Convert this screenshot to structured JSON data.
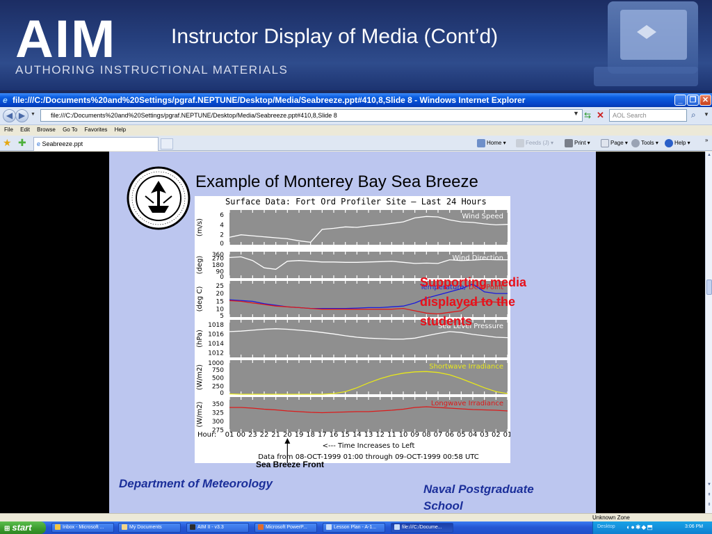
{
  "slide": {
    "logo_text": "AIM",
    "logo_subtitle": "AUTHORING INSTRUCTIONAL MATERIALS",
    "title": "Instructor Display of Media (Cont’d)"
  },
  "browser": {
    "title": "file:///C:/Documents%20and%20Settings/pgraf.NEPTUNE/Desktop/Media/Seabreeze.ppt#410,8,Slide 8 - Windows Internet Explorer",
    "address": "file:///C:/Documents%20and%20Settings/pgraf.NEPTUNE/Desktop/Media/Seabreeze.ppt#410,8,Slide 8",
    "search_placeholder": "AOL Search",
    "menu": [
      "File",
      "Edit",
      "Browse",
      "Go To",
      "Favorites",
      "Help"
    ],
    "tab_label": "Seabreeze.ppt",
    "commands": {
      "home": "Home",
      "feeds": "Feeds (J)",
      "print": "Print",
      "page": "Page",
      "tools": "Tools",
      "help": "Help"
    },
    "status_zone": "Unknown Zone"
  },
  "content": {
    "chart_heading": "Example of Monterey Bay Sea Breeze",
    "annotation": "Supporting media displayed to the students",
    "footer_left": "Department of Meteorology",
    "footer_right": "Naval  Postgraduate School",
    "seabreeze_label": "Sea Breeze Front"
  },
  "chart_data": {
    "type": "line",
    "title": "Surface  Data:  Fort  Ord  Profiler  Site  —  Last  24  Hours",
    "x_tick_labels": [
      "01",
      "00",
      "23",
      "22",
      "21",
      "20",
      "19",
      "18",
      "17",
      "16",
      "15",
      "14",
      "13",
      "12",
      "11",
      "10",
      "09",
      "08",
      "07",
      "06",
      "05",
      "04",
      "03",
      "02",
      "01"
    ],
    "x_prefix": "Hour:",
    "x_note": "<---  Time  Increases  to  Left",
    "x_caption": "Data  from  08-OCT-1999  01:00  through  09-OCT-1999  00:58  UTC",
    "panels": [
      {
        "name": "Wind  Speed",
        "ylabel": "(m/s)",
        "ticks": [
          "6",
          "4",
          "2",
          "0"
        ],
        "ylim": [
          0,
          7
        ],
        "color": "#ffffff",
        "values": [
          1.5,
          2.0,
          1.8,
          1.6,
          1.4,
          1.2,
          0.8,
          0.5,
          3.1,
          3.3,
          3.6,
          3.5,
          3.8,
          4.0,
          4.3,
          4.6,
          5.4,
          5.7,
          5.6,
          5.0,
          4.6,
          4.5,
          4.2,
          4.0,
          4.1
        ]
      },
      {
        "name": "Wind  Direction",
        "ylabel": "(deg)",
        "ticks": [
          "360",
          "270",
          "180",
          "90",
          "0"
        ],
        "ylim": [
          0,
          360
        ],
        "color": "#ffffff",
        "values": [
          280,
          290,
          240,
          140,
          120,
          230,
          240,
          230,
          220,
          220,
          215,
          215,
          220,
          225,
          230,
          215,
          200,
          205,
          200,
          250,
          240,
          245,
          255,
          250,
          250
        ]
      },
      {
        "name": "Temperature/  Dew  Point",
        "ylabel": "(deg  C)",
        "ticks": [
          "25",
          "20",
          "15",
          "10",
          "5"
        ],
        "ylim": [
          5,
          28
        ],
        "series": [
          {
            "name": "Temperature",
            "color": "#1a1adc",
            "values": [
              16,
              15.5,
              15,
              13.5,
              12.5,
              11.5,
              11,
              10.5,
              10.5,
              10.5,
              10.5,
              10.7,
              11,
              11,
              11.5,
              12,
              14,
              17,
              19,
              21,
              23,
              26,
              21,
              20,
              20
            ]
          },
          {
            "name": "Dew  Point",
            "color": "#dc1a1a",
            "values": [
              15.5,
              15,
              14,
              13,
              12,
              11.5,
              11,
              10.5,
              10,
              10,
              10,
              10,
              10,
              10,
              10,
              10.5,
              9,
              7.5,
              7,
              8,
              9,
              14,
              15,
              14.5,
              14
            ]
          }
        ]
      },
      {
        "name": "Sea  Level  Pressure",
        "ylabel": "(hPa)",
        "ticks": [
          "1018",
          "1016",
          "1014",
          "1012"
        ],
        "ylim": [
          1011,
          1019
        ],
        "color": "#ffffff",
        "values": [
          1016.5,
          1016.6,
          1016.8,
          1017.0,
          1017.1,
          1017.0,
          1016.8,
          1016.6,
          1016.3,
          1016.0,
          1015.6,
          1015.3,
          1015.1,
          1015.0,
          1014.9,
          1014.9,
          1015.1,
          1015.6,
          1016.1,
          1016.5,
          1016.3,
          1015.9,
          1015.6,
          1015.3,
          1015.2
        ]
      },
      {
        "name": "Shortwave  Irradiance",
        "ylabel": "(W/m2)",
        "ticks": [
          "1000",
          "750",
          "500",
          "250",
          "0"
        ],
        "ylim": [
          0,
          1050
        ],
        "color": "#e8e81a",
        "values": [
          10,
          0,
          0,
          0,
          0,
          0,
          0,
          0,
          0,
          20,
          80,
          200,
          350,
          480,
          580,
          650,
          690,
          700,
          670,
          600,
          480,
          340,
          200,
          80,
          20
        ]
      },
      {
        "name": "Longwave  Irradiance",
        "ylabel": "(W/m2)",
        "ticks": [
          "350",
          "325",
          "300",
          "275"
        ],
        "ylim": [
          270,
          370
        ],
        "color": "#dc1a1a",
        "values": [
          340,
          340,
          338,
          335,
          333,
          330,
          328,
          326,
          325,
          326,
          327,
          328,
          328,
          330,
          332,
          335,
          340,
          342,
          340,
          338,
          336,
          334,
          333,
          332,
          330
        ]
      }
    ]
  }
}
